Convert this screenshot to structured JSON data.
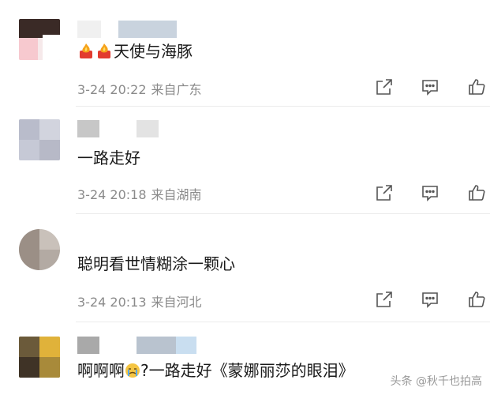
{
  "comments": [
    {
      "text": "天使与海豚",
      "date": "3-24 20:22",
      "location": "来自广东",
      "prefix_icons": [
        "fire-emoji-icon",
        "fire-emoji-icon"
      ]
    },
    {
      "text": "一路走好",
      "date": "3-24 20:18",
      "location": "来自湖南"
    },
    {
      "text": "聪明看世情糊涂一颗心",
      "date": "3-24 20:13",
      "location": "来自河北"
    },
    {
      "text_before_emoji": "啊啊啊",
      "text_after_emoji": "?一路走好《蒙娜丽莎的眼泪》",
      "emoji": "crying-face-icon"
    }
  ],
  "actions": [
    "share-icon",
    "comment-icon",
    "like-icon"
  ],
  "watermark": "头条 @秋千也拍高"
}
